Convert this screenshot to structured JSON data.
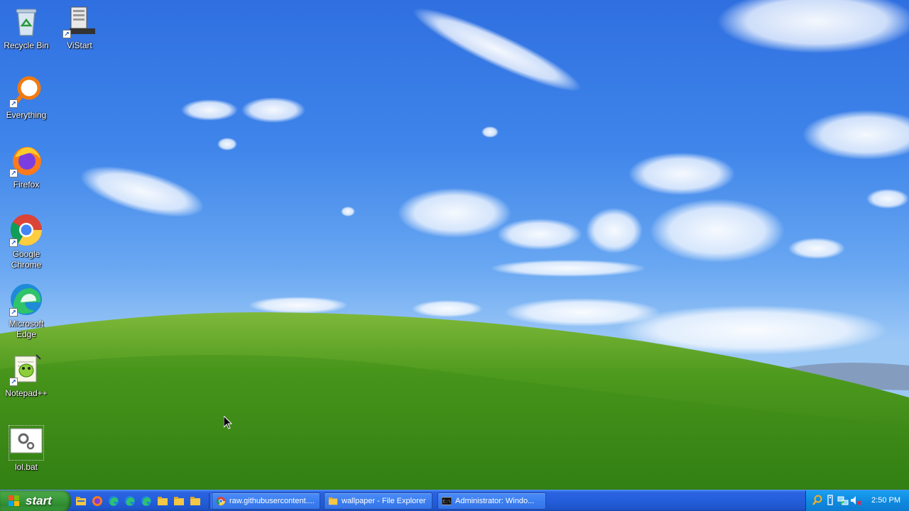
{
  "desktop": {
    "icons": [
      {
        "label": "Recycle Bin",
        "icon": "recycle-bin-icon"
      },
      {
        "label": "ViStart",
        "icon": "vistart-icon"
      },
      {
        "label": "Everything",
        "icon": "everything-search-icon"
      },
      {
        "label": "Firefox",
        "icon": "firefox-icon"
      },
      {
        "label": "Google Chrome",
        "icon": "chrome-icon"
      },
      {
        "label": "Microsoft Edge",
        "icon": "edge-icon"
      },
      {
        "label": "Notepad++",
        "icon": "notepadpp-icon"
      },
      {
        "label": "lol.bat",
        "icon": "batch-file-icon"
      }
    ]
  },
  "taskbar": {
    "start_label": "start",
    "quick_launch": [
      "file-explorer-icon",
      "firefox-icon",
      "edge-icon",
      "edge-icon",
      "edge-icon",
      "folder-icon",
      "folder-icon",
      "folder-icon"
    ],
    "tasks": [
      {
        "label": "raw.githubusercontent....",
        "icon": "chrome-icon"
      },
      {
        "label": "wallpaper - File Explorer",
        "icon": "folder-icon"
      },
      {
        "label": "Administrator:  Windo...",
        "icon": "cmd-icon"
      }
    ],
    "tray_icons": [
      "search-icon",
      "usb-device-icon",
      "network-icon",
      "volume-muted-icon"
    ],
    "clock": "2:50 PM"
  },
  "colors": {
    "taskbar": "#245edb",
    "start_button": "#3b9b3b",
    "tray": "#0f8ae0"
  }
}
